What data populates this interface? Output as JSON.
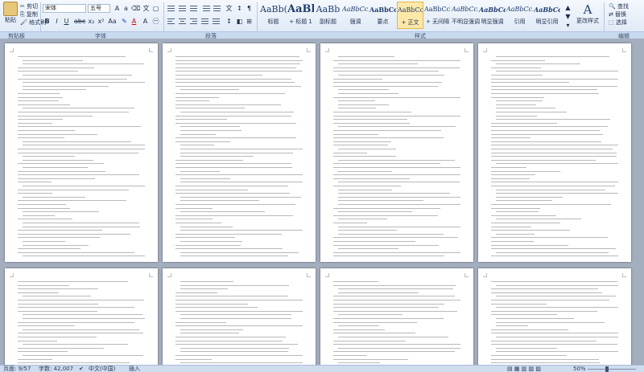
{
  "ribbon": {
    "clipboard": {
      "paste_label": "粘贴",
      "cut_label": "剪切",
      "copy_label": "复制",
      "format_painter_label": "格式刷",
      "group_label": "剪贴板"
    },
    "font": {
      "font_name": "宋体",
      "font_size": "五号",
      "group_label": "字体"
    },
    "paragraph": {
      "group_label": "段落"
    },
    "styles": {
      "group_label": "样式",
      "items": [
        {
          "sample": "AaBb(",
          "name": "标题"
        },
        {
          "sample": "AaBl",
          "name": "+ 标题 1"
        },
        {
          "sample": "AaBb",
          "name": "副标题"
        },
        {
          "sample": "AaBbCcD",
          "name": "强调"
        },
        {
          "sample": "AaBbCcD",
          "name": "要点"
        },
        {
          "sample": "AaBbCcD",
          "name": "+ 正文"
        },
        {
          "sample": "AaBbCcD",
          "name": "+ 无间隔"
        },
        {
          "sample": "AaBbCcD",
          "name": "不明显强调"
        },
        {
          "sample": "AaBbCcD",
          "name": "明显强调"
        },
        {
          "sample": "AaBbCcD",
          "name": "引用"
        },
        {
          "sample": "AaBbCcD",
          "name": "明显引用"
        }
      ],
      "change_styles_label": "更改样式"
    },
    "editing": {
      "group_label": "编辑",
      "find_label": "查找",
      "replace_label": "替换",
      "select_label": "选择"
    }
  },
  "statusbar": {
    "page": "页面: 9/57",
    "words": "字数: 42,007",
    "language": "中文(中国)",
    "mode": "插入",
    "zoom": "50%"
  },
  "colors": {
    "ribbon_bg": "#dde8f5",
    "doc_bg": "#a3aebf",
    "selected_style": "#fde8a8"
  }
}
